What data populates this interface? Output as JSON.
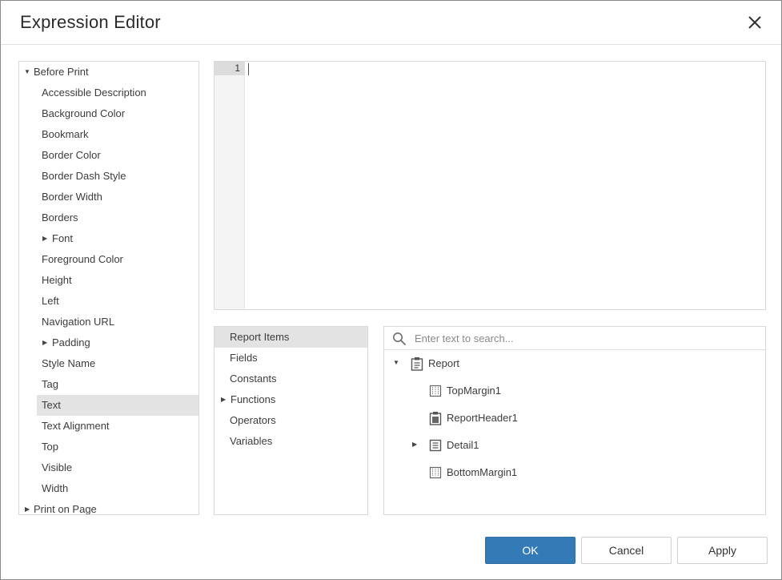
{
  "dialog": {
    "title": "Expression Editor",
    "close_icon": "close-icon"
  },
  "property_tree": {
    "items": [
      {
        "label": "Before Print",
        "expander": "expanded"
      },
      {
        "label": "Accessible Description"
      },
      {
        "label": "Background Color"
      },
      {
        "label": "Bookmark"
      },
      {
        "label": "Border Color"
      },
      {
        "label": "Border Dash Style"
      },
      {
        "label": "Border Width"
      },
      {
        "label": "Borders"
      },
      {
        "label": "Font",
        "expander": "collapsed"
      },
      {
        "label": "Foreground Color"
      },
      {
        "label": "Height"
      },
      {
        "label": "Left"
      },
      {
        "label": "Navigation URL"
      },
      {
        "label": "Padding",
        "expander": "collapsed"
      },
      {
        "label": "Style Name"
      },
      {
        "label": "Tag"
      },
      {
        "label": "Text",
        "selected": true
      },
      {
        "label": "Text Alignment"
      },
      {
        "label": "Top"
      },
      {
        "label": "Visible"
      },
      {
        "label": "Width"
      },
      {
        "label": "Print on Page",
        "expander": "collapsed"
      }
    ]
  },
  "editor": {
    "line_number": "1",
    "content": ""
  },
  "categories": {
    "items": [
      {
        "label": "Report Items",
        "selected": true
      },
      {
        "label": "Fields"
      },
      {
        "label": "Constants"
      },
      {
        "label": "Functions",
        "expander": "collapsed"
      },
      {
        "label": "Operators"
      },
      {
        "label": "Variables"
      }
    ]
  },
  "items_panel": {
    "search": {
      "placeholder": "Enter text to search...",
      "value": ""
    },
    "tree": [
      {
        "label": "Report",
        "icon": "report-icon",
        "expander": "expanded"
      },
      {
        "label": "TopMargin1",
        "icon": "margin-band-icon"
      },
      {
        "label": "ReportHeader1",
        "icon": "report-header-icon"
      },
      {
        "label": "Detail1",
        "icon": "detail-band-icon",
        "expander": "collapsed"
      },
      {
        "label": "BottomMargin1",
        "icon": "margin-band-icon"
      }
    ]
  },
  "buttons": {
    "ok": "OK",
    "cancel": "Cancel",
    "apply": "Apply"
  },
  "colors": {
    "primary": "#337ab7",
    "selection": "#e3e3e3",
    "border": "#d9d9d9"
  }
}
